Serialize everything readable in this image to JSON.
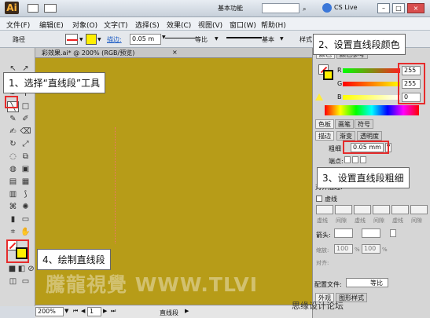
{
  "app": {
    "logo": "Ai",
    "workspace": "基本功能",
    "cs_live": "CS Live"
  },
  "menus": [
    "文件(F)",
    "编辑(E)",
    "对象(O)",
    "文字(T)",
    "选择(S)",
    "效果(C)",
    "视图(V)",
    "窗口(W)",
    "帮助(H)"
  ],
  "control_bar": {
    "object_label": "路径",
    "stroke_label": "描边:",
    "stroke_value": "0.05 m",
    "profile_label": "等比",
    "brush_label": "基本",
    "style_label": "样式"
  },
  "document": {
    "tab_title": "彩效果.ai* @ 200% (RGB/预览)",
    "zoom": "200%",
    "page": "1",
    "tool_name": "直线段"
  },
  "callouts": {
    "step1": "1、选择“直线段”工具",
    "step2": "2、设置直线段颜色",
    "step3": "3、设置直线段粗细",
    "step4": "4、绘制直线段"
  },
  "color_panel": {
    "tabs": [
      "颜色",
      "颜色参考"
    ],
    "r_label": "R",
    "r_value": "255",
    "g_label": "G",
    "g_value": "255",
    "b_label": "B",
    "b_value": "0",
    "colors": {
      "r": "#ff1f1f",
      "g": "#1fa11f",
      "b": "#4d6df1"
    }
  },
  "swatches_panel": {
    "tabs": [
      "色板",
      "画笔",
      "符号"
    ]
  },
  "stroke_panel": {
    "tabs": [
      "描边",
      "渐变",
      "透明度"
    ],
    "weight_label": "粗细",
    "weight_value": "0.05 mm",
    "cap_label": "端点:",
    "align_label": "对齐描边:",
    "dash_label": "虚线",
    "dash_fields": [
      "虚线",
      "间隙",
      "虚线",
      "间隙",
      "虚线",
      "间隙"
    ],
    "arrow_label": "箭头:",
    "scale_label": "缩放:",
    "scale_value_1": "100",
    "scale_value_2": "100",
    "percent": "%",
    "align_label2": "对齐:",
    "profile_label": "配置文件:",
    "profile_value": "等比"
  },
  "bottom_panels": {
    "tabs": [
      "外观",
      "图形样式"
    ]
  },
  "watermarks": {
    "main": "騰龍視覺 WWW.TLVI",
    "corner": "思缘设计论坛"
  },
  "brand_colors": {
    "canvas": "#b79c18",
    "callout_border": "#e62c2c"
  }
}
